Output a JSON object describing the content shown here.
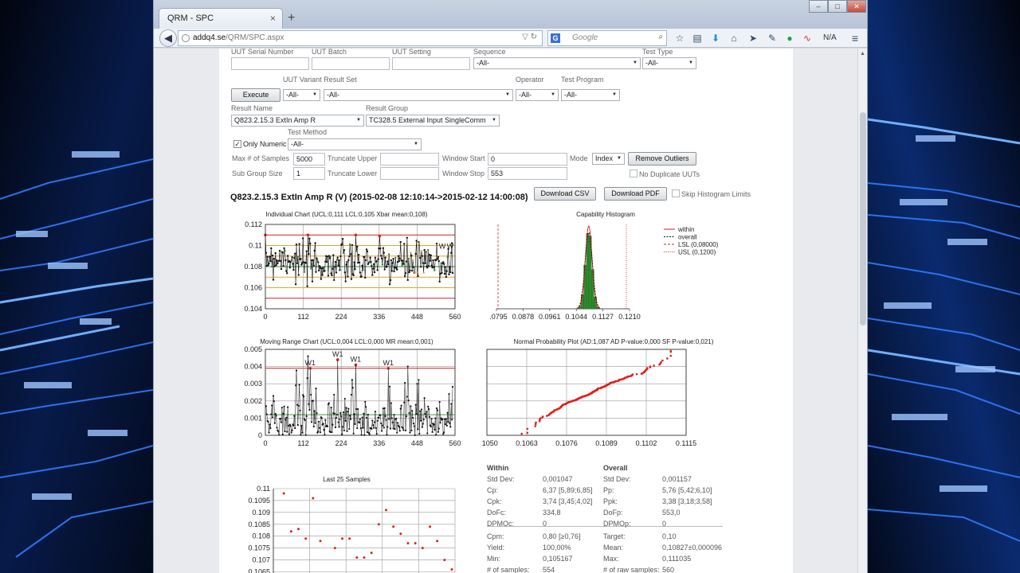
{
  "browser": {
    "tab_title": "QRM - SPC",
    "tab_close": "×",
    "new_tab": "+",
    "url_domain": "addq4.se",
    "url_path": "/QRM/SPC.aspx",
    "search_engine": "G",
    "search_placeholder": "Google",
    "status_na": "N/A",
    "win_min": "–",
    "win_max": "□",
    "win_close": "✕"
  },
  "filters": {
    "uut_serial_label": "UUT Serial Number",
    "uut_batch_label": "UUT Batch",
    "uut_setting_label": "UUT Setting",
    "sequence_label": "Sequence",
    "sequence_value": "-All-",
    "test_type_label": "Test Type",
    "test_type_value": "-All-",
    "variant_label": "UUT Variant Result Set",
    "execute_label": "Execute",
    "variant_value": "-All-",
    "result_set_value": "-All-",
    "operator_label": "Operator",
    "operator_value": "-All-",
    "test_program_label": "Test Program",
    "test_program_value": "-All-",
    "result_name_label": "Result Name",
    "result_name_value": "Q823.2.15.3 ExtIn Amp R",
    "result_group_label": "Result Group",
    "result_group_value": "TC328.5 External Input SingleComm",
    "test_method_label": "Test Method",
    "only_numeric_label": "Only Numeric",
    "test_method_value": "-All-",
    "max_samples_label": "Max # of Samples",
    "max_samples_value": "5000",
    "truncate_upper_label": "Truncate Upper",
    "window_start_label": "Window Start",
    "window_start_value": "0",
    "mode_label": "Mode",
    "mode_value": "Index",
    "remove_outliers_label": "Remove Outliers",
    "subgroup_label": "Sub Group Size",
    "subgroup_value": "1",
    "truncate_lower_label": "Truncate Lower",
    "window_stop_label": "Window Stop",
    "window_stop_value": "553",
    "no_duplicate_label": "No Duplicate UUTs"
  },
  "report": {
    "heading": "Q823.2.15.3 ExtIn Amp R (V) (2015-02-08 12:10:14->2015-02-12 14:00:08)",
    "download_csv": "Download CSV",
    "download_pdf": "Download PDF",
    "skip_histogram_label": "Skip Histogram Limits"
  },
  "chart_data": [
    {
      "type": "line",
      "title": "Individual Chart (UCL:0,111 LCL:0,105 Xbar mean:0,108)",
      "ylim": [
        0.104,
        0.112
      ],
      "y_ticks": [
        "0.112",
        "0.11",
        "0.108",
        "0.106",
        "0.104"
      ],
      "xlim": [
        0,
        560
      ],
      "x_ticks": [
        "0",
        "112",
        "224",
        "336",
        "448",
        "560"
      ],
      "ucl": 0.111,
      "lcl": 0.105,
      "mean": 0.108,
      "rule_labels": [
        "W",
        "W"
      ]
    },
    {
      "type": "bar",
      "title": "Capability Histogram",
      "x_ticks": [
        "0.0795",
        "0.0878",
        "0.0961",
        "0.1044",
        "0.1127",
        "0.1210"
      ],
      "legend": [
        "within",
        "overall",
        "LSL (0,08000)",
        "USL (0,1200)"
      ],
      "lsl": 0.08,
      "usl": 0.12
    },
    {
      "type": "line",
      "title": "Moving Range Chart (UCL:0,004 LCL:0,000 MR mean:0,001)",
      "ylim": [
        0,
        0.005
      ],
      "y_ticks": [
        "0.005",
        "0.004",
        "0.003",
        "0.002",
        "0.001",
        "0"
      ],
      "xlim": [
        0,
        560
      ],
      "x_ticks": [
        "0",
        "112",
        "224",
        "336",
        "448",
        "560"
      ],
      "rule_labels": [
        "W1",
        "W1",
        "W1",
        "W1"
      ]
    },
    {
      "type": "scatter",
      "title": "Normal Probability Plot (AD:1,087 AD P-value:0,000 SF P-value:0,021)",
      "xlim": [
        0.105,
        0.1115
      ],
      "x_ticks": [
        "0.1050",
        "0.1063",
        "0.1076",
        "0.1089",
        "0.1102",
        "0.1115"
      ]
    },
    {
      "type": "scatter",
      "title": "Last 25 Samples",
      "ylim": [
        0.1065,
        0.11
      ],
      "y_ticks": [
        "0.11",
        "0.1095",
        "0.109",
        "0.1085",
        "0.108",
        "0.1075",
        "0.107",
        "0.1065"
      ],
      "values": [
        0.1064,
        0.1098,
        0.1082,
        0.1083,
        0.1079,
        0.1096,
        0.1078,
        0.1064,
        0.1075,
        0.1079,
        0.1079,
        0.1071,
        0.1071,
        0.1073,
        0.1085,
        0.1091,
        0.1084,
        0.1081,
        0.1077,
        0.1077,
        0.1075,
        0.1084,
        0.1078,
        0.107,
        0.1066
      ]
    }
  ],
  "stats": {
    "within_title": "Within",
    "overall_title": "Overall",
    "within": [
      {
        "k": "Std Dev:",
        "v": "0,001047"
      },
      {
        "k": "Cp:",
        "v": "6,37 [5,89;6,85]"
      },
      {
        "k": "Cpk:",
        "v": "3,74 [3,45;4,02]"
      },
      {
        "k": "DoFc:",
        "v": "334,8"
      },
      {
        "k": "DPMOc:",
        "v": "0"
      },
      {
        "k": "Cpm:",
        "v": "0,80 [≥0,76]"
      },
      {
        "k": "Yield:",
        "v": "100,00%"
      },
      {
        "k": "Min:",
        "v": "0,105167"
      },
      {
        "k": "# of samples:",
        "v": "554"
      }
    ],
    "overall": [
      {
        "k": "Std Dev:",
        "v": "0,001157"
      },
      {
        "k": "Pp:",
        "v": "5,76 [5,42;6,10]"
      },
      {
        "k": "Ppk:",
        "v": "3,38 [3,18;3,58]"
      },
      {
        "k": "DoFp:",
        "v": "553,0"
      },
      {
        "k": "DPMOp:",
        "v": "0"
      },
      {
        "k": "Target:",
        "v": "0,10"
      },
      {
        "k": "Mean:",
        "v": "0,10827±0,000096"
      },
      {
        "k": "Max:",
        "v": "0,111035"
      },
      {
        "k": "# of raw samples:",
        "v": "560"
      }
    ]
  },
  "colors": {
    "data_line": "#111111",
    "point_red": "#e0201c",
    "limit_red": "#d22020",
    "histogram_green": "#2e8b2e",
    "zone_gold": "#e1a72b"
  }
}
